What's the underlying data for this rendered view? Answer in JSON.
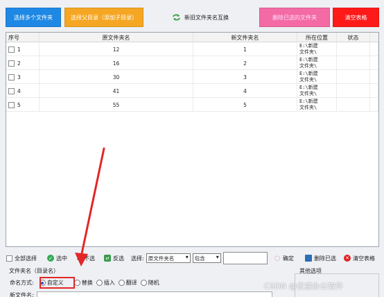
{
  "toolbar": {
    "select_files": "选择多个文件夹",
    "select_parent": "选择父目录（添加子目录）",
    "swap_label": "新旧文件夹名互换",
    "delete_selected": "删除已选的文件夹",
    "clear_table": "清空表格"
  },
  "table": {
    "headers": [
      "序号",
      "原文件夹名",
      "新文件夹名",
      "所在位置",
      "状态"
    ],
    "rows": [
      {
        "index": "1",
        "old": "12",
        "new": "1",
        "loc1": "E:\\新建",
        "loc2": "文件夹\\",
        "status": ""
      },
      {
        "index": "2",
        "old": "16",
        "new": "2",
        "loc1": "E:\\新建",
        "loc2": "文件夹\\",
        "status": ""
      },
      {
        "index": "3",
        "old": "30",
        "new": "3",
        "loc1": "E:\\新建",
        "loc2": "文件夹\\",
        "status": ""
      },
      {
        "index": "4",
        "old": "41",
        "new": "4",
        "loc1": "E:\\新建",
        "loc2": "文件夹\\",
        "status": ""
      },
      {
        "index": "5",
        "old": "55",
        "new": "5",
        "loc1": "E:\\新建",
        "loc2": "文件夹\\",
        "status": ""
      }
    ]
  },
  "bottom": {
    "select_all": "全部选择",
    "select": "选中",
    "deselect": "不选",
    "invert": "反选",
    "choose_label": "选择:",
    "field_select": "原文件夹名",
    "match_select": "包含",
    "confirm": "确定",
    "delete_selected": "删除已选",
    "clear_table": "清空表格"
  },
  "section": {
    "title": "文件夹名（目录名）",
    "mode_label": "命名方式:",
    "modes": [
      "自定义",
      "替换",
      "插入",
      "翻译",
      "随机"
    ],
    "new_name_label": "新文件名:",
    "other_title": "其他选项"
  },
  "watermark": "CSDN @优速办公软件"
}
